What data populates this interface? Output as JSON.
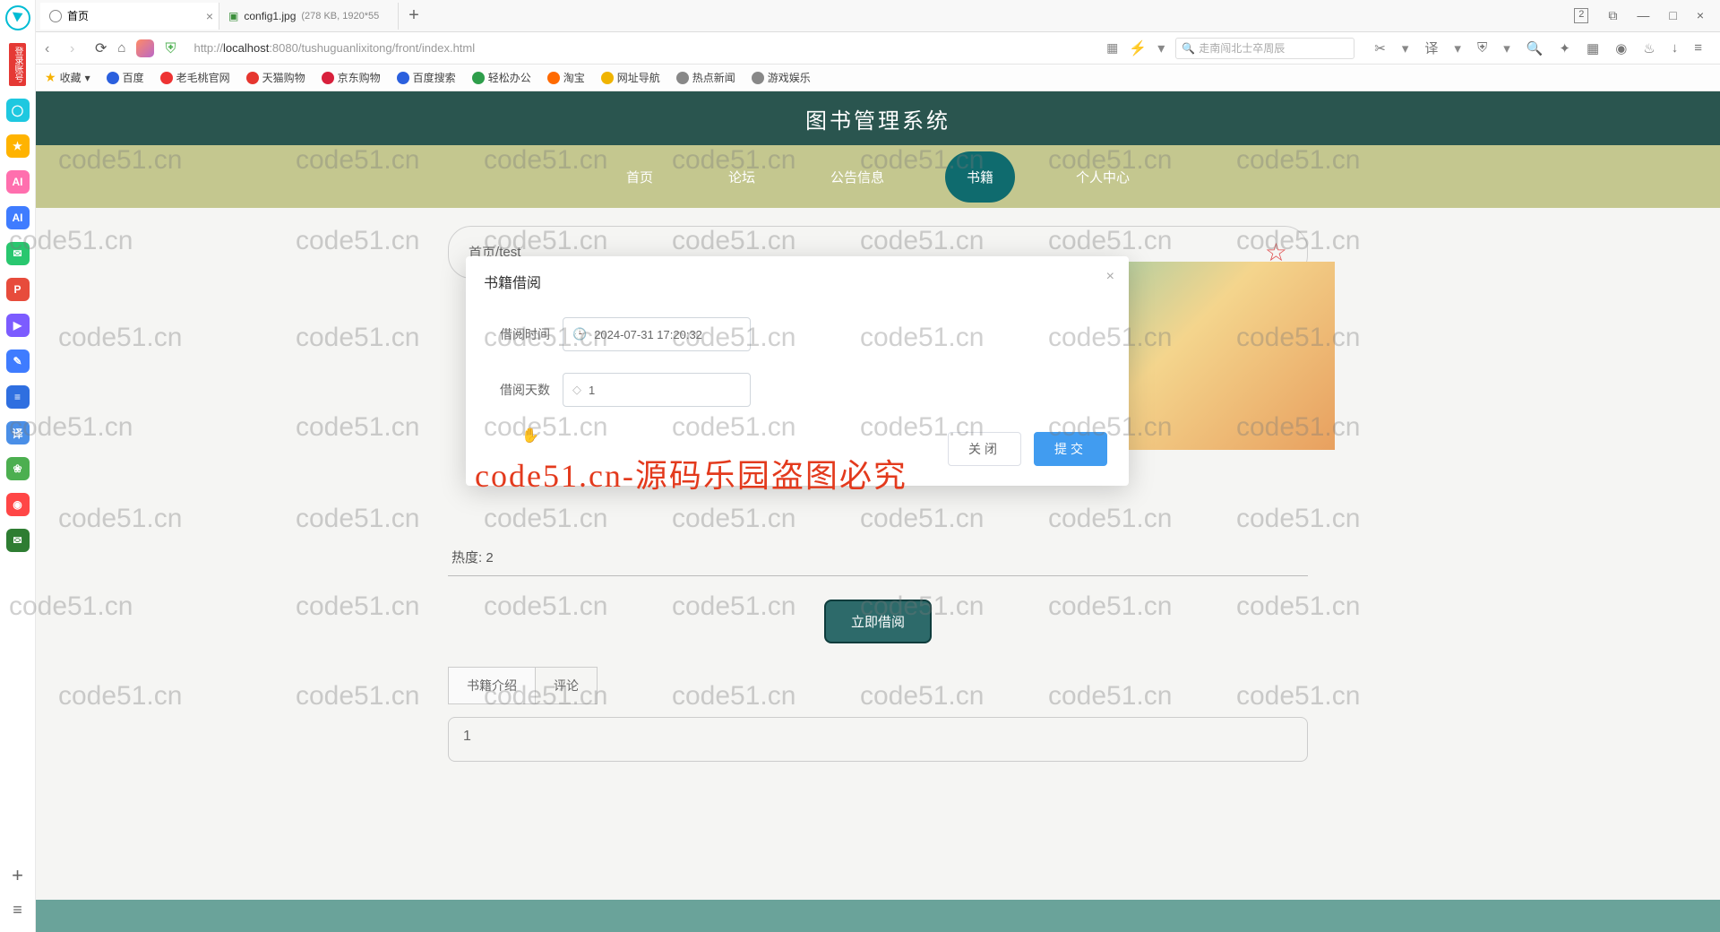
{
  "browser": {
    "tabs": [
      {
        "title": "首页",
        "active": true
      },
      {
        "title": "config1.jpg",
        "meta": "(278 KB, 1920*55"
      }
    ],
    "url_pre": "http://",
    "url_host": "localhost",
    "url_rest": ":8080/tushuguanlixitong/front/index.html",
    "search_placeholder": "走南闯北士卒周辰",
    "win_num": "2",
    "bookmarks": [
      "收藏",
      "百度",
      "老毛桃官网",
      "天猫购物",
      "京东购物",
      "百度搜索",
      "轻松办公",
      "淘宝",
      "网址导航",
      "热点新闻",
      "游戏娱乐"
    ]
  },
  "leftrail": {
    "login": "登录账号"
  },
  "app": {
    "title": "图书管理系统",
    "nav": {
      "home": "首页",
      "forum": "论坛",
      "notice": "公告信息",
      "book": "书籍",
      "profile": "个人中心"
    },
    "crumb_home": "首页",
    "crumb_sep": " / ",
    "crumb_cur": "test",
    "hot_label": "热度:",
    "hot_val": " 2",
    "borrow_btn": "立即借阅",
    "tab_intro": "书籍介绍",
    "tab_comment": "评论",
    "desc": "1"
  },
  "modal": {
    "title": "书籍借阅",
    "time_label": "借阅时间",
    "time_value": "2024-07-31 17:20:32",
    "days_label": "借阅天数",
    "days_value": "1",
    "close": "关闭",
    "submit": "提交"
  },
  "watermark": {
    "small": "code51.cn",
    "big": "code51.cn-源码乐园盗图必究"
  }
}
